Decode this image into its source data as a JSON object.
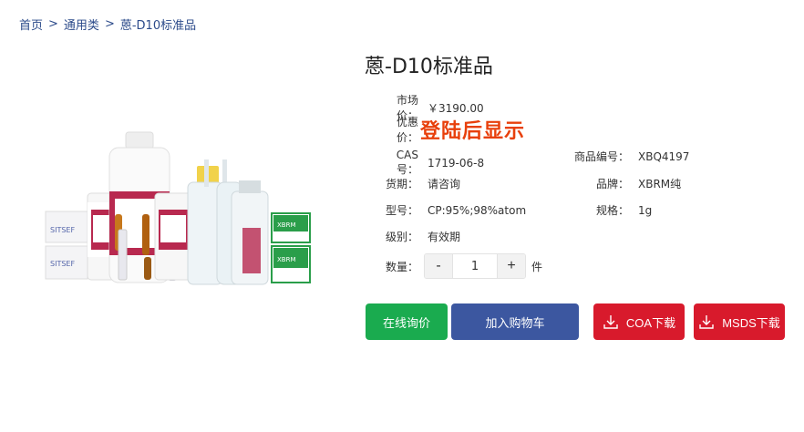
{
  "breadcrumb": {
    "home": "首页",
    "category": "通用类",
    "current": "蒽-D10标准品",
    "separator": ">"
  },
  "product": {
    "title": "蒽-D10标准品",
    "market_price_label": "市场价：",
    "market_price": "￥3190.00",
    "promo_label": "优惠价：",
    "promo_text": "登陆后显示",
    "cas_label": "CAS号：",
    "cas": "1719-06-8",
    "code_label": "商品编号：",
    "code": "XBQ4197",
    "delivery_label": "货期：",
    "delivery": "请咨询",
    "brand_label": "品牌：",
    "brand": "XBRM纯",
    "model_label": "型号：",
    "model": "CP:95%;98%atom",
    "spec_label": "规格：",
    "spec": "1g",
    "grade_label": "级别：",
    "grade": "有效期",
    "qty_label": "数量：",
    "qty_value": "1",
    "qty_unit": "件",
    "qty_minus": "-",
    "qty_plus": "+"
  },
  "image_labels": {
    "box_brand": "SITSEF",
    "box_logo": "XBRM"
  },
  "buttons": {
    "inquiry": "在线询价",
    "add_cart": "加入购物车",
    "coa": "COA下载",
    "msds": "MSDS下载"
  },
  "colors": {
    "promo": "#e8400c",
    "green": "#1aab4f",
    "blue": "#3c57a0",
    "red": "#d81a2c",
    "breadcrumb": "#2b4a8a"
  }
}
